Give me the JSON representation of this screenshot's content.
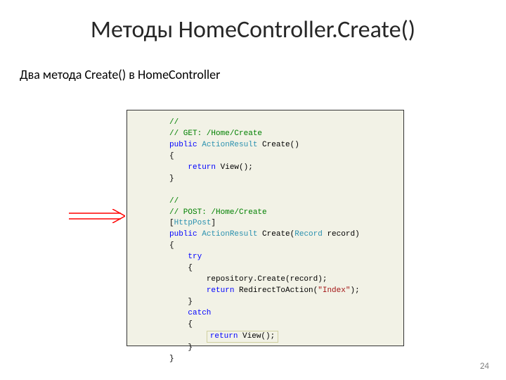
{
  "title": "Методы HomeController.Create()",
  "subtitle": "Два метода Create() в HomeController",
  "page_number": "24",
  "code": {
    "l1": "//",
    "l2": "// GET: /Home/Create",
    "l3a": "public",
    "l3b": "ActionResult",
    "l3c": " Create()",
    "l4": "{",
    "l5a": "return",
    "l5b": " View();",
    "l6": "}",
    "l8": "//",
    "l9": "// POST: /Home/Create",
    "l10a": "[",
    "l10b": "HttpPost",
    "l10c": "]",
    "l11a": "public",
    "l11b": "ActionResult",
    "l11c": " Create(",
    "l11d": "Record",
    "l11e": " record)",
    "l12": "{",
    "l13": "try",
    "l14": "{",
    "l15": "repository.Create(record);",
    "l16a": "return",
    "l16b": " RedirectToAction(",
    "l16c": "\"Index\"",
    "l16d": ");",
    "l17": "}",
    "l18": "catch",
    "l19": "{",
    "l20a": "return",
    "l20b": " View();",
    "l21": "}",
    "l22": "}"
  }
}
